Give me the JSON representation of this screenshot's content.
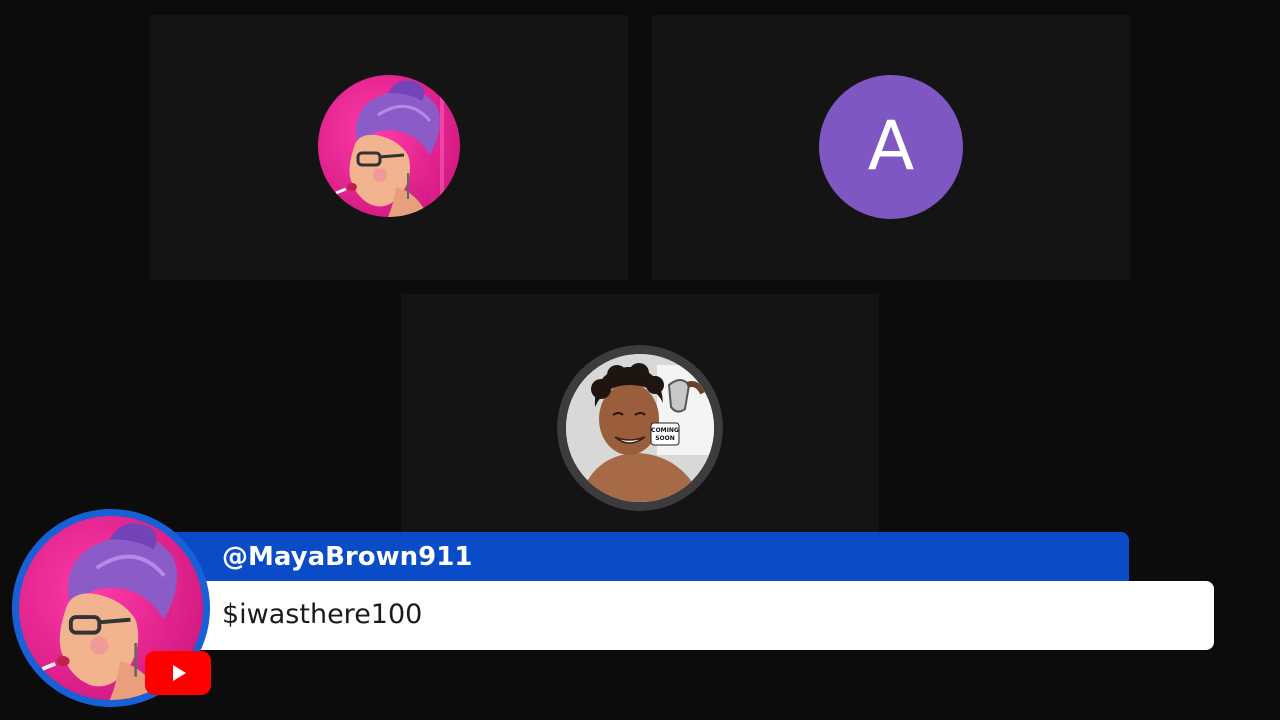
{
  "participants": [
    {
      "type": "image",
      "description_icon": "woman-purple-hair-avatar-icon"
    },
    {
      "type": "letter",
      "letter": "A",
      "color": "#7e57c2"
    },
    {
      "type": "image",
      "description_icon": "man-smiling-coming-soon-avatar-icon",
      "badge_text": "COMING SOON"
    }
  ],
  "chat": {
    "author": "@MayaBrown911",
    "message": "$iwasthere100",
    "platform_icon": "youtube-icon",
    "name_bar_color": "#0a4cc7",
    "ring_color": "#1760d6"
  }
}
